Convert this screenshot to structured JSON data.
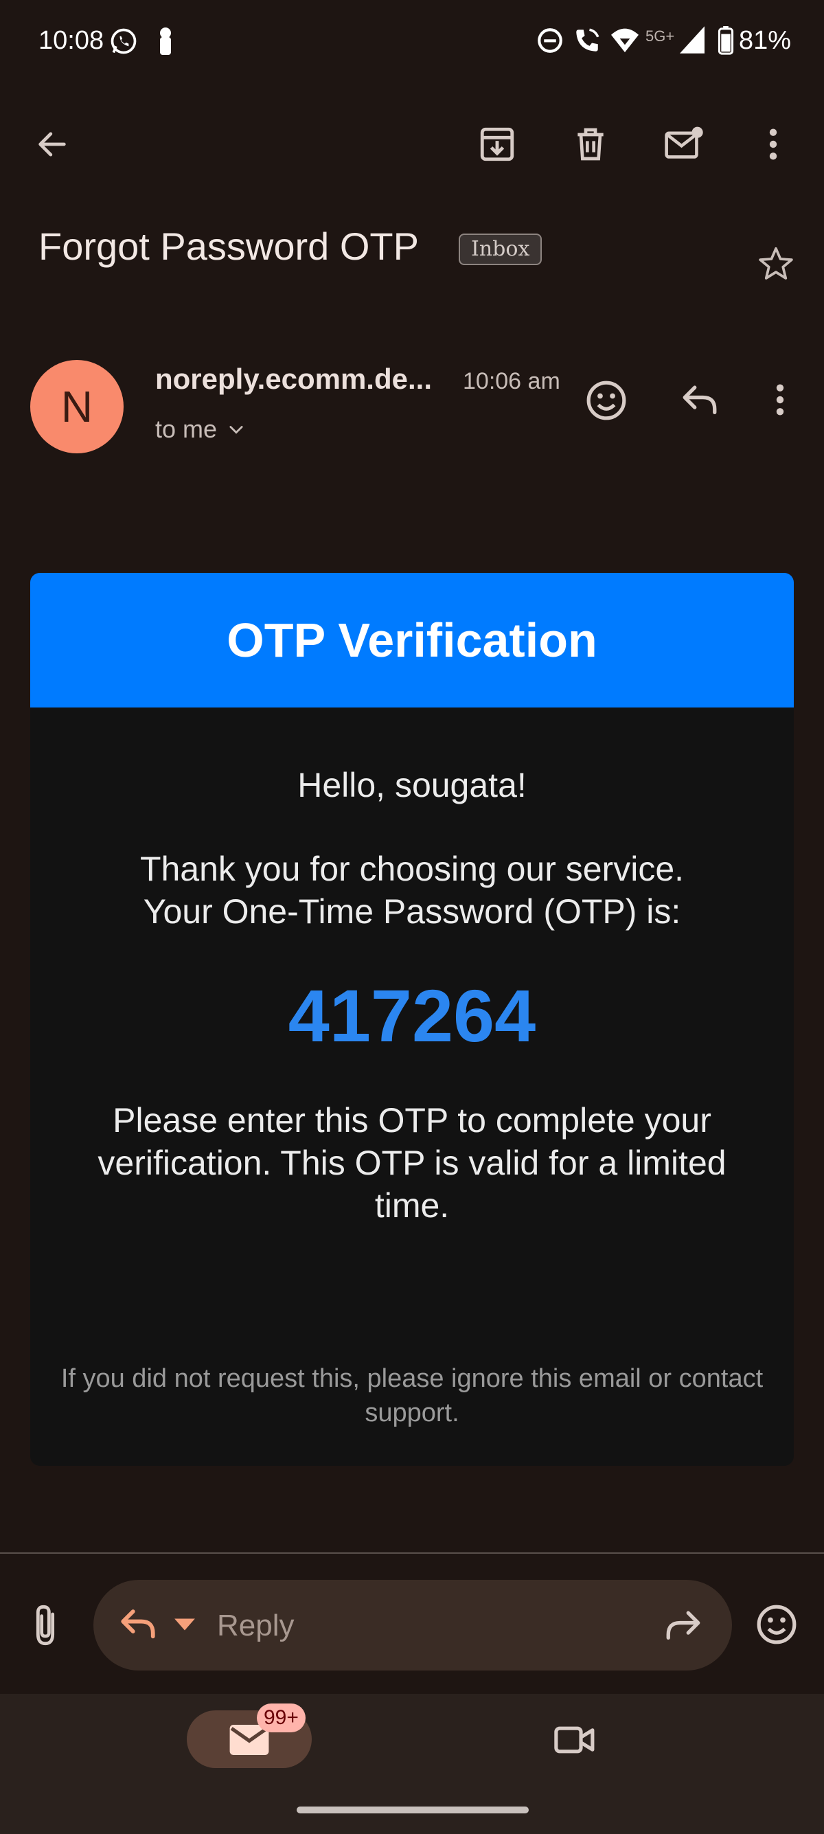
{
  "status_bar": {
    "time": "10:08",
    "network_label": "5G+",
    "battery": "81%",
    "icons": [
      "whatsapp-icon",
      "notification-icon",
      "do-not-disturb-icon",
      "wifi-calling-icon",
      "wifi-icon",
      "signal-icon",
      "battery-icon"
    ]
  },
  "toolbar": {
    "icons": [
      "back-arrow-icon",
      "archive-icon",
      "delete-icon",
      "mark-unread-icon",
      "more-vert-icon"
    ]
  },
  "email": {
    "subject": "Forgot Password OTP",
    "label": "Inbox",
    "sender_initial": "N",
    "sender": "noreply.ecomm.de...",
    "time": "10:06 am",
    "recipient": "to me"
  },
  "body": {
    "header": "OTP Verification",
    "greeting": "Hello, sougata!",
    "intro_line1": "Thank you for choosing our service.",
    "intro_line2": "Your One-Time Password (OTP) is:",
    "otp": "417264",
    "instructions": "Please enter this OTP to complete your verification. This OTP is valid for a limited time.",
    "footer": "If you did not request this, please ignore this email or contact support."
  },
  "reply_bar": {
    "placeholder": "Reply",
    "icons": [
      "attachment-icon",
      "reply-icon",
      "dropdown-arrow-icon",
      "forward-icon",
      "emoji-icon"
    ]
  },
  "bottom_nav": {
    "mail_badge": "99+",
    "icons": [
      "mail-icon",
      "video-icon"
    ]
  },
  "colors": {
    "background": "#1e1512",
    "header_blue": "#007bff",
    "otp_blue": "#2b86f0",
    "avatar": "#f98a6c",
    "accent_orange": "#f5a07a"
  }
}
